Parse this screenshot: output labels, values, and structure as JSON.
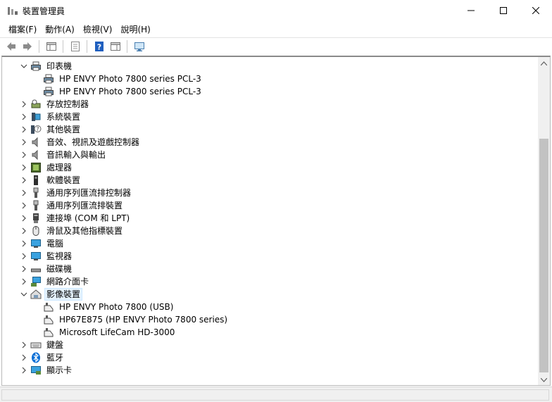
{
  "window": {
    "title": "裝置管理員",
    "icon": "device-manager-icon"
  },
  "menu": [
    {
      "label": "檔案(F)"
    },
    {
      "label": "動作(A)"
    },
    {
      "label": "檢視(V)"
    },
    {
      "label": "說明(H)"
    }
  ],
  "toolbar": {
    "buttons": [
      "back-arrow-icon",
      "forward-arrow-icon",
      "show-hide-console-tree-icon",
      "properties-icon",
      "help-icon",
      "action-pane-icon",
      "scan-hardware-icon"
    ]
  },
  "tree": {
    "items": [
      {
        "label": "印表機",
        "expanded": true,
        "icon": "printer-icon",
        "level": 0
      },
      {
        "label": "HP ENVY Photo 7800 series PCL-3",
        "icon": "printer-icon",
        "level": 1
      },
      {
        "label": "HP ENVY Photo 7800 series PCL-3",
        "icon": "printer-icon",
        "level": 1
      },
      {
        "label": "存放控制器",
        "expanded": false,
        "icon": "storage-controller-icon",
        "level": 0
      },
      {
        "label": "系統裝置",
        "expanded": false,
        "icon": "system-device-icon",
        "level": 0
      },
      {
        "label": "其他裝置",
        "expanded": false,
        "icon": "unknown-device-icon",
        "level": 0
      },
      {
        "label": "音效、視訊及遊戲控制器",
        "expanded": false,
        "icon": "speaker-icon",
        "level": 0
      },
      {
        "label": "音訊輸入與輸出",
        "expanded": false,
        "icon": "speaker-icon",
        "level": 0
      },
      {
        "label": "處理器",
        "expanded": false,
        "icon": "processor-icon",
        "level": 0
      },
      {
        "label": "軟體裝置",
        "expanded": false,
        "icon": "software-device-icon",
        "level": 0
      },
      {
        "label": "通用序列匯流排控制器",
        "expanded": false,
        "icon": "usb-icon",
        "level": 0
      },
      {
        "label": "通用序列匯流排裝置",
        "expanded": false,
        "icon": "usb-icon",
        "level": 0
      },
      {
        "label": "連接埠 (COM 和 LPT)",
        "expanded": false,
        "icon": "port-icon",
        "level": 0
      },
      {
        "label": "滑鼠及其他指標裝置",
        "expanded": false,
        "icon": "mouse-icon",
        "level": 0
      },
      {
        "label": "電腦",
        "expanded": false,
        "icon": "computer-icon",
        "level": 0
      },
      {
        "label": "監視器",
        "expanded": false,
        "icon": "monitor-icon",
        "level": 0
      },
      {
        "label": "磁碟機",
        "expanded": false,
        "icon": "disk-drive-icon",
        "level": 0
      },
      {
        "label": "網路介面卡",
        "expanded": false,
        "icon": "network-adapter-icon",
        "level": 0
      },
      {
        "label": "影像裝置",
        "expanded": true,
        "selected": true,
        "icon": "imaging-device-icon",
        "level": 0
      },
      {
        "label": "HP ENVY Photo 7800 (USB)",
        "icon": "scanner-icon",
        "level": 1
      },
      {
        "label": "HP67E875 (HP ENVY Photo 7800 series)",
        "icon": "scanner-icon",
        "level": 1
      },
      {
        "label": "Microsoft LifeCam HD-3000",
        "icon": "camera-icon",
        "level": 1
      },
      {
        "label": "鍵盤",
        "expanded": false,
        "icon": "keyboard-icon",
        "level": 0
      },
      {
        "label": "藍牙",
        "expanded": false,
        "icon": "bluetooth-icon",
        "level": 0
      },
      {
        "label": "顯示卡",
        "expanded": false,
        "icon": "display-adapter-icon",
        "level": 0
      }
    ]
  },
  "colors": {
    "selection_bg": "#e5f3ff",
    "bluetooth": "#0a6fd6",
    "toolbar_blue": "#1f5fbf"
  }
}
